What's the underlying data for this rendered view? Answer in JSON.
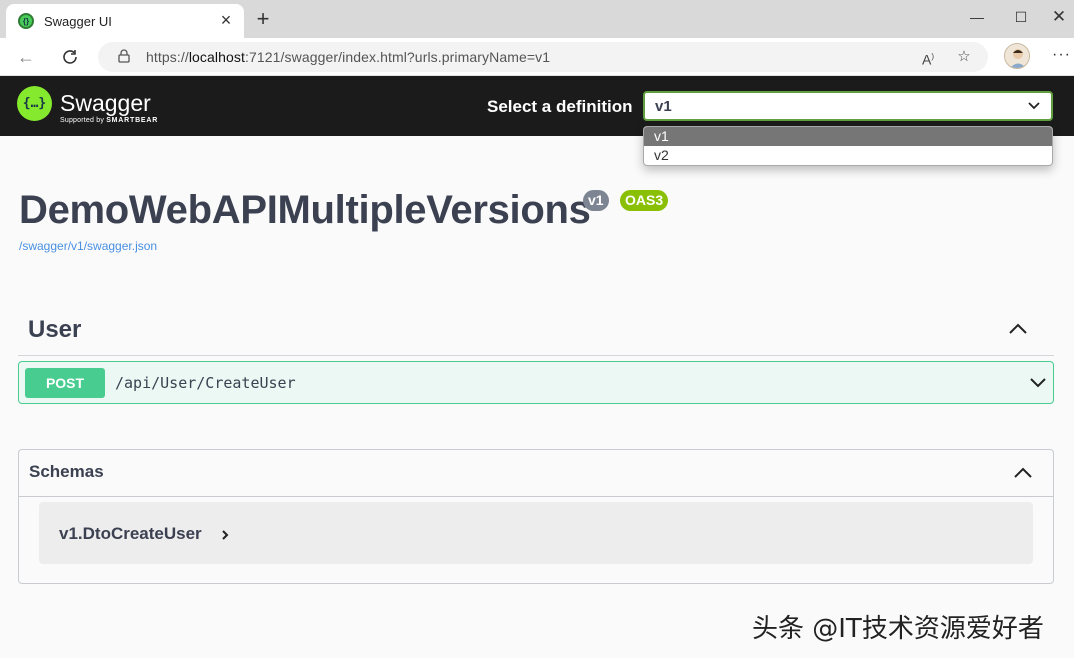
{
  "browser": {
    "tab_title": "Swagger UI",
    "url_prefix": "https://",
    "url_host": "localhost",
    "url_rest": ":7121/swagger/index.html?urls.primaryName=v1"
  },
  "topbar": {
    "logo_text": "Swagger",
    "logo_sub_prefix": "Supported by ",
    "logo_sub_brand": "SMARTBEAR",
    "select_label": "Select a definition",
    "selected_value": "v1",
    "options": [
      "v1",
      "v2"
    ]
  },
  "info": {
    "title": "DemoWebAPIMultipleVersions",
    "version_badge": "v1",
    "oas_badge": "OAS3",
    "spec_link": "/swagger/v1/swagger.json"
  },
  "tag": {
    "name": "User",
    "operations": [
      {
        "method": "POST",
        "path": "/api/User/CreateUser"
      }
    ]
  },
  "schemas": {
    "title": "Schemas",
    "models": [
      "v1.DtoCreateUser"
    ]
  },
  "watermark": "头条 @IT技术资源爱好者",
  "colors": {
    "topbar_bg": "#1b1b1b",
    "logo_green": "#85ea2d",
    "post_green": "#49cc90",
    "oas_badge": "#89bf04",
    "version_badge": "#7d8492"
  }
}
